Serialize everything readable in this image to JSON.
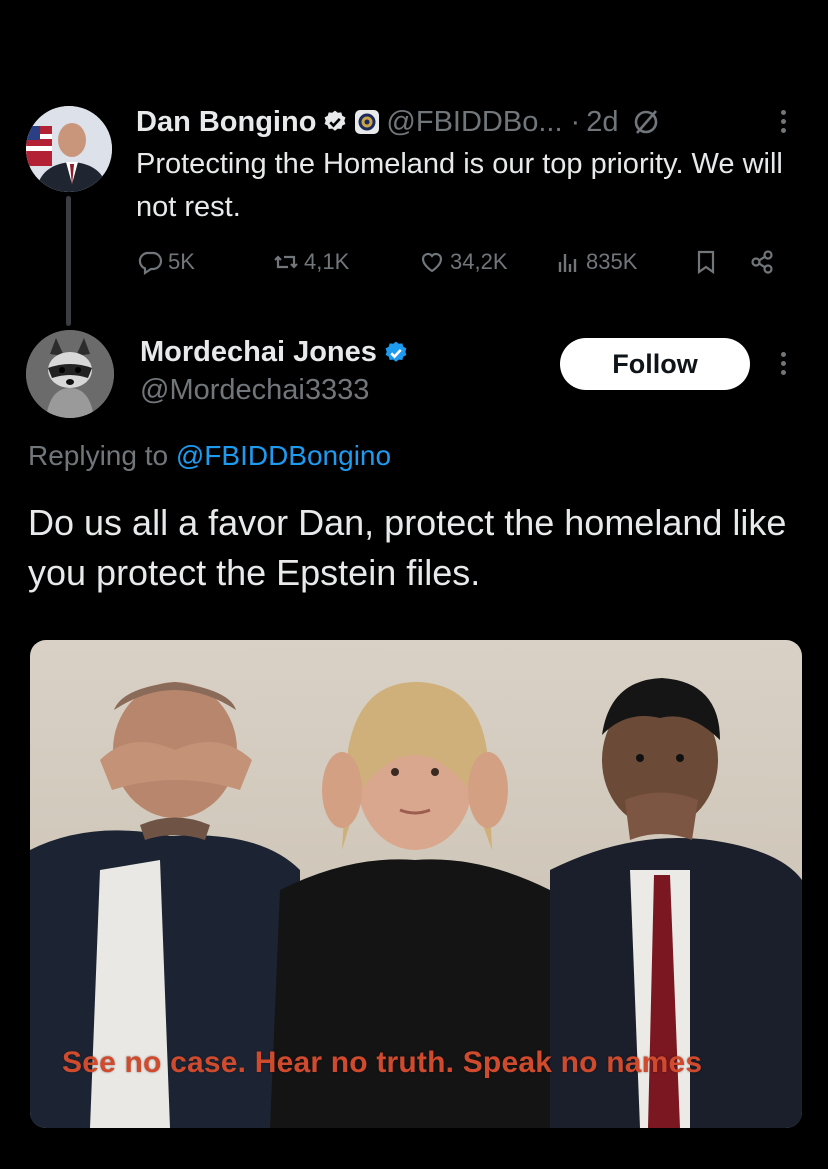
{
  "tweet": {
    "author_name": "Dan Bongino",
    "handle": "@FBIDDBo...",
    "separator": "·",
    "time": "2d",
    "text": "Protecting the Homeland is our top priority. We will not rest.",
    "stats": {
      "replies": "5K",
      "reposts": "4,1K",
      "likes": "34,2K",
      "views": "835K"
    },
    "icons": {
      "verified": "verified-badge-icon",
      "agency": "fbi-seal-icon",
      "grok": "grok-icon",
      "more": "more-vertical-icon"
    }
  },
  "reply": {
    "author_name": "Mordechai Jones",
    "handle": "@Mordechai3333",
    "follow_label": "Follow",
    "replying_prefix": "Replying to",
    "replying_to": "@FBIDDBongino",
    "text": "Do us all a favor Dan, protect the homeland like you protect the Epstein files.",
    "media": {
      "caption": "See no case. Hear no truth. Speak no names"
    }
  },
  "colors": {
    "background": "#000000",
    "primary_text": "#e7e9ea",
    "secondary_text": "#71767b",
    "accent": "#1d9bf0",
    "caption": "#d04a2e"
  }
}
